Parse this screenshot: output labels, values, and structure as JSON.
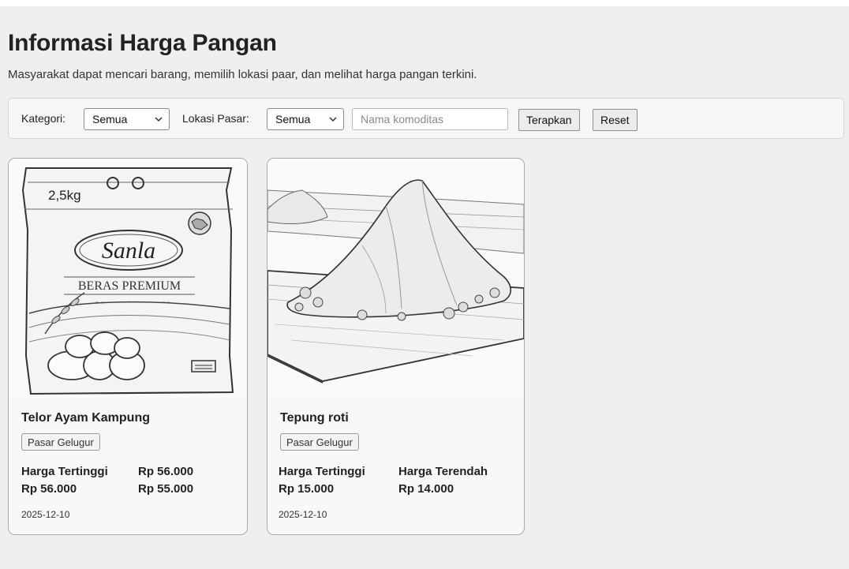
{
  "header": {
    "title": "Informasi Harga Pangan",
    "subtitle": "Masyarakat dapat mencari barang, memilih lokasi paar, dan melihat harga pangan terkini."
  },
  "filters": {
    "category_label": "Kategori:",
    "category_value": "Semua",
    "market_label": "Lokasi Pasar:",
    "market_value": "Semua",
    "commodity_placeholder": "Nama komoditas",
    "commodity_value": "",
    "apply_label": "Terapkan",
    "reset_label": "Reset"
  },
  "products": [
    {
      "name": "Telor Ayam Kampung",
      "market": "Pasar Gelugur",
      "price_row1_left": "Harga Tertinggi",
      "price_row1_right": "Rp 56.000",
      "price_row2_left": "Rp 56.000",
      "price_row2_right": "Rp 55.000",
      "date": "2025-12-10",
      "image_icon": "rice-bag-image",
      "image_text": {
        "weight": "2,5kg",
        "brand": "Sanla",
        "variant": "BERAS PREMIUM"
      }
    },
    {
      "name": "Tepung roti",
      "market": "Pasar Gelugur",
      "price_row1_left": "Harga Tertinggi",
      "price_row1_right": "Harga Terendah",
      "price_row2_left": "Rp 15.000",
      "price_row2_right": "Rp 14.000",
      "date": "2025-12-10",
      "image_icon": "flour-pile-image"
    }
  ]
}
